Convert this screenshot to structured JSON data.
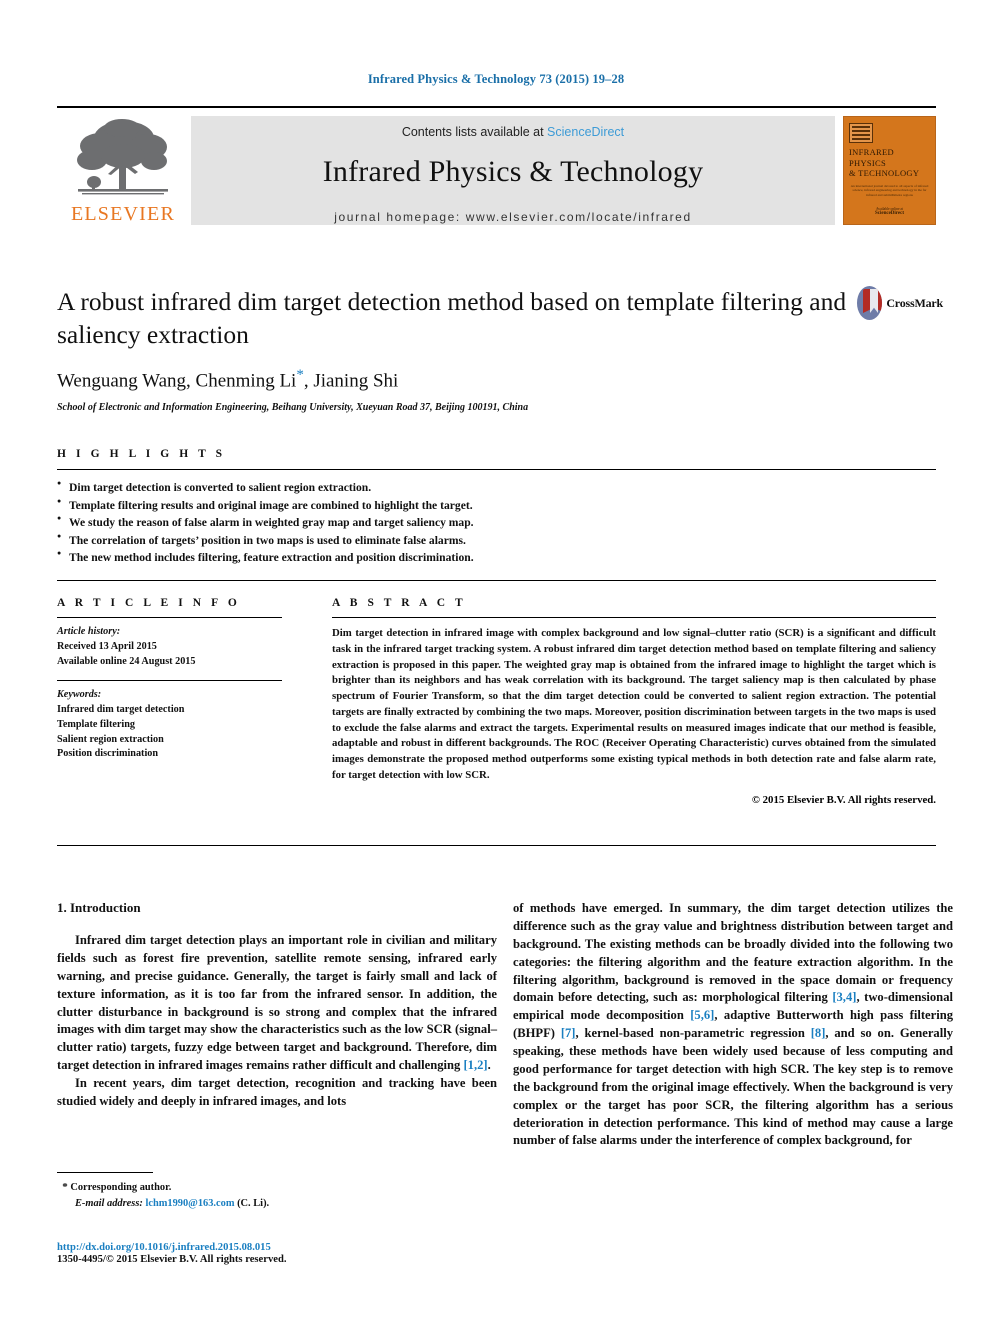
{
  "running_head": "Infrared Physics & Technology 73 (2015) 19–28",
  "masthead": {
    "publisher_name": "ELSEVIER",
    "publisher_logo": "elsevier-tree-logo",
    "contents_prefix": "Contents lists available at ",
    "contents_link": "ScienceDirect",
    "journal_title": "Infrared Physics & Technology",
    "journal_homepage": "journal homepage: www.elsevier.com/locate/infrared",
    "cover": {
      "title_line1": "INFRARED PHYSICS",
      "title_line2": "& TECHNOLOGY",
      "subtitle": "An international journal devoted to all aspects of infrared science, infrared engineering and technology in the far infrared and submillimetre regions",
      "footer_label": "Available online at",
      "footer_brand": "ScienceDirect"
    }
  },
  "article": {
    "title": "A robust infrared dim target detection method based on template filtering and saliency extraction",
    "authors": "Wenguang Wang, Chenming Li",
    "authors_star": "*",
    "authors_rest": ", Jianing Shi",
    "affiliation": "School of Electronic and Information Engineering, Beihang University, Xueyuan Road 37, Beijing 100191, China",
    "crossmark_label": "CrossMark"
  },
  "highlights": {
    "heading": "H I G H L I G H T S",
    "items": [
      "Dim target detection is converted to salient region extraction.",
      "Template filtering results and original image are combined to highlight the target.",
      "We study the reason of false alarm in weighted gray map and target saliency map.",
      "The correlation of targets’ position in two maps is used to eliminate false alarms.",
      "The new method includes filtering, feature extraction and position discrimination."
    ]
  },
  "article_info": {
    "heading": "A R T I C L E    I N F O",
    "history_label": "Article history:",
    "history": [
      "Received 13 April 2015",
      "Available online 24 August 2015"
    ],
    "keywords_label": "Keywords:",
    "keywords": [
      "Infrared dim target detection",
      "Template filtering",
      "Salient region extraction",
      "Position discrimination"
    ]
  },
  "abstract": {
    "heading": "A B S T R A C T",
    "text": "Dim target detection in infrared image with complex background and low signal–clutter ratio (SCR) is a significant and difficult task in the infrared target tracking system. A robust infrared dim target detection method based on template filtering and saliency extraction is proposed in this paper. The weighted gray map is obtained from the infrared image to highlight the target which is brighter than its neighbors and has weak correlation with its background. The target saliency map is then calculated by phase spectrum of Fourier Transform, so that the dim target detection could be converted to salient region extraction. The potential targets are finally extracted by combining the two maps. Moreover, position discrimination between targets in the two maps is used to exclude the false alarms and extract the targets. Experimental results on measured images indicate that our method is feasible, adaptable and robust in different backgrounds. The ROC (Receiver Operating Characteristic) curves obtained from the simulated images demonstrate the proposed method outperforms some existing typical methods in both detection rate and false alarm rate, for target detection with low SCR.",
    "copyright": "© 2015 Elsevier B.V. All rights reserved."
  },
  "body": {
    "section_heading": "1. Introduction",
    "left_p1": "Infrared dim target detection plays an important role in civilian and military fields such as forest fire prevention, satellite remote sensing, infrared early warning, and precise guidance. Generally, the target is fairly small and lack of texture information, as it is too far from the infrared sensor. In addition, the clutter disturbance in background is so strong and complex that the infrared images with dim target may show the characteristics such as the low SCR (signal–clutter ratio) targets, fuzzy edge between target and background. Therefore, dim target detection in infrared images remains rather difficult and challenging ",
    "left_p1_ref": "[1,2]",
    "left_p1_end": ".",
    "left_p2": "In recent years, dim target detection, recognition and tracking have been studied widely and deeply in infrared images, and lots",
    "right_seg1": "of methods have emerged. In summary, the dim target detection utilizes the difference such as the gray value and brightness distribution between target and background. The existing methods can be broadly divided into the following two categories: the filtering algorithm and the feature extraction algorithm. In the filtering algorithm, background is removed in the space domain or frequency domain before detecting, such as: morphological filtering ",
    "right_ref1": "[3,4]",
    "right_seg2": ", two-dimensional empirical mode decomposition ",
    "right_ref2": "[5,6]",
    "right_seg3": ", adaptive Butterworth high pass filtering (BHPF) ",
    "right_ref3": "[7]",
    "right_seg4": ", kernel-based non-parametric regression ",
    "right_ref4": "[8]",
    "right_seg5": ", and so on. Generally speaking, these methods have been widely used because of less computing and good performance for target detection with high SCR. The key step is to remove the background from the original image effectively. When the background is very complex or the target has poor SCR, the filtering algorithm has a serious deterioration in detection performance. This kind of method may cause a large number of false alarms under the interference of complex background, for"
  },
  "footnote": {
    "star": "*",
    "corresponding": "Corresponding author.",
    "email_label": "E-mail address:",
    "email": "lchm1990@163.com",
    "email_owner": "(C. Li)."
  },
  "colophon": {
    "doi": "http://dx.doi.org/10.1016/j.infrared.2015.08.015",
    "issn_line": "1350-4495/© 2015 Elsevier B.V. All rights reserved."
  },
  "colors": {
    "link": "#1a7fc1",
    "running_head": "#1a6fa8",
    "elsevier_orange": "#E87722",
    "band_gray": "#e3e3e3",
    "cover_orange": "#d4761c"
  }
}
